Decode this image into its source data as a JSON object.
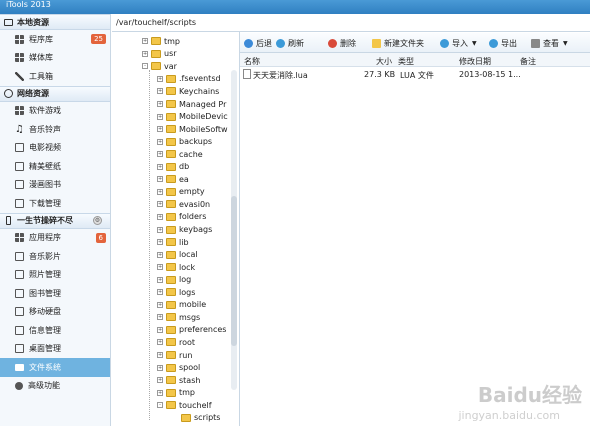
{
  "app": {
    "title": "iTools 2013"
  },
  "path": "/var/touchelf/scripts",
  "sidebar": {
    "sections": [
      {
        "label": "本地资源",
        "items": [
          {
            "label": "程序库",
            "badge": "25"
          },
          {
            "label": "媒体库"
          },
          {
            "label": "工具箱"
          }
        ]
      },
      {
        "label": "网络资源",
        "items": [
          {
            "label": "软件游戏"
          },
          {
            "label": "音乐铃声"
          },
          {
            "label": "电影视频"
          },
          {
            "label": "精美壁纸"
          },
          {
            "label": "漫画图书"
          },
          {
            "label": "下载管理"
          }
        ]
      },
      {
        "label": "一生节操碎不尽",
        "items": [
          {
            "label": "应用程序",
            "badge": "6"
          },
          {
            "label": "音乐影片"
          },
          {
            "label": "照片管理"
          },
          {
            "label": "图书管理"
          },
          {
            "label": "移动硬盘"
          },
          {
            "label": "信息管理"
          },
          {
            "label": "桌面管理"
          },
          {
            "label": "文件系统"
          },
          {
            "label": "高级功能"
          }
        ]
      }
    ]
  },
  "tree": {
    "top": [
      "tmp",
      "usr",
      "var"
    ],
    "var_children": [
      ".fseventsd",
      "Keychains",
      "Managed Pr",
      "MobileDevic",
      "MobileSoftw",
      "backups",
      "cache",
      "db",
      "ea",
      "empty",
      "evasi0n",
      "folders",
      "keybags",
      "lib",
      "local",
      "lock",
      "log",
      "logs",
      "mobile",
      "msgs",
      "preferences",
      "root",
      "run",
      "spool",
      "stash",
      "tmp",
      "touchelf"
    ],
    "touchelf_children": [
      "scripts"
    ]
  },
  "toolbar": {
    "back": "后退",
    "refresh": "刷新",
    "delete": "删除",
    "new_folder": "新建文件夹",
    "import": "导入",
    "export": "导出",
    "view": "查看"
  },
  "columns": {
    "name": "名称",
    "size": "大小",
    "type": "类型",
    "modified": "修改日期",
    "note": "备注"
  },
  "files": [
    {
      "name": "天天爱消除.lua",
      "size": "27.3 KB",
      "type": "LUA 文件",
      "modified": "2013-08-15 1..."
    }
  ],
  "watermark": {
    "main": "Baidu经验",
    "sub": "jingyan.baidu.com"
  }
}
